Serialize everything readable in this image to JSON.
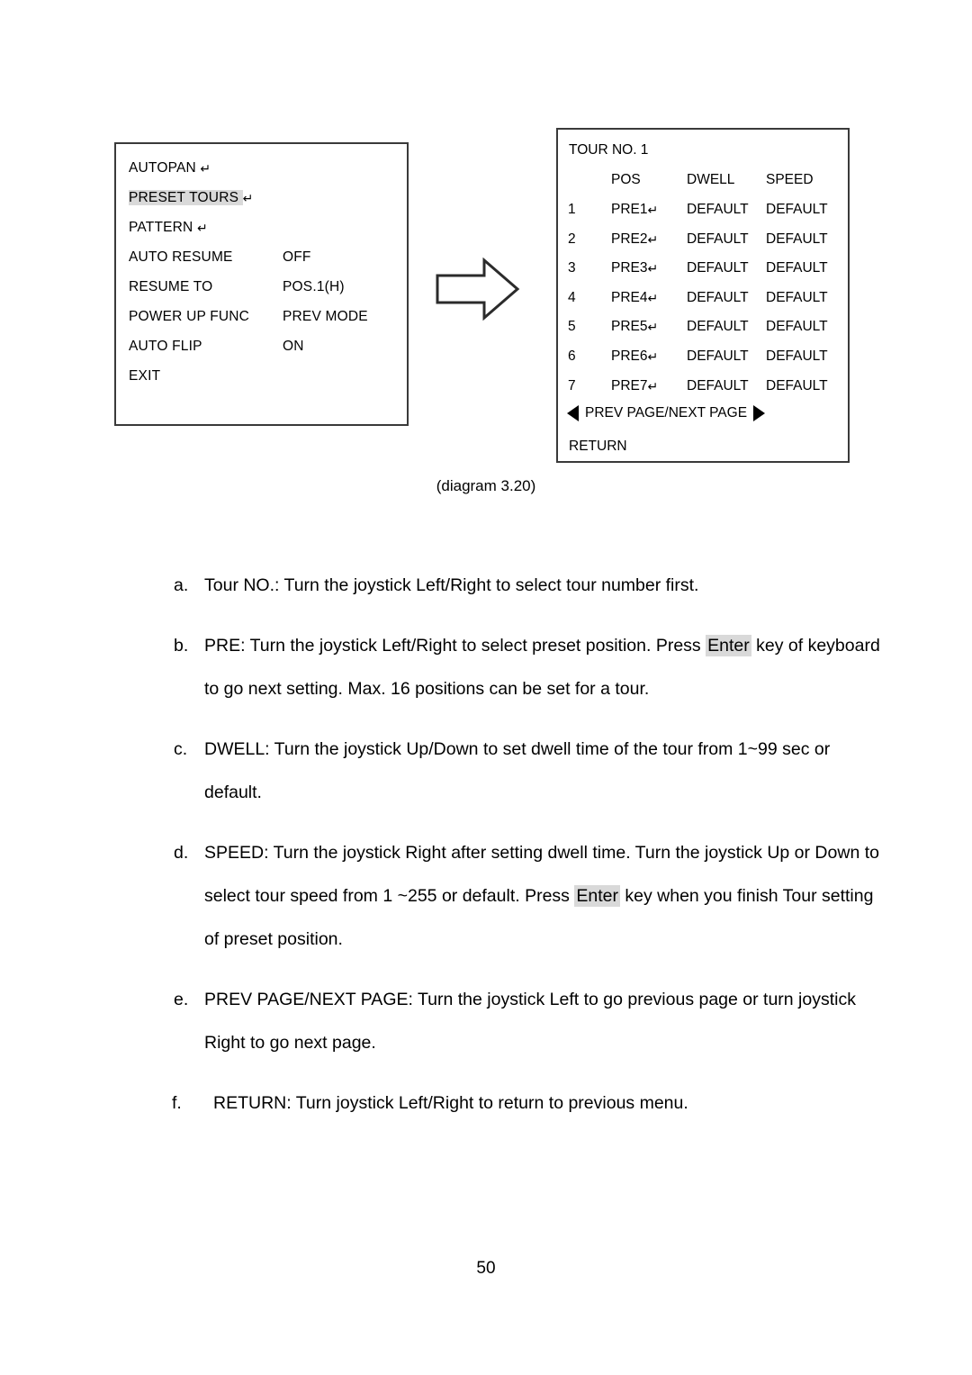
{
  "main_menu": {
    "rows": [
      {
        "label": "AUTOPAN",
        "enter_mark": "↵",
        "value": "",
        "highlight": false
      },
      {
        "label": "PRESET TOURS",
        "enter_mark": "↵",
        "value": "",
        "highlight": true
      },
      {
        "label": "PATTERN",
        "enter_mark": "↵",
        "value": "",
        "highlight": false
      },
      {
        "label": "AUTO RESUME",
        "enter_mark": "",
        "value": "OFF",
        "highlight": false
      },
      {
        "label": "RESUME TO",
        "enter_mark": "",
        "value": "POS.1(H)",
        "highlight": false
      },
      {
        "label": "POWER UP FUNC",
        "enter_mark": "",
        "value": "PREV MODE",
        "highlight": false
      },
      {
        "label": "AUTO FLIP",
        "enter_mark": "",
        "value": "ON",
        "highlight": false
      },
      {
        "label": "EXIT",
        "enter_mark": "",
        "value": "",
        "highlight": false
      }
    ]
  },
  "tour_menu": {
    "title": "TOUR NO.  1",
    "headers": {
      "index": "",
      "pos": "POS",
      "dwell": "DWELL",
      "speed": "SPEED"
    },
    "rows": [
      {
        "index": "1",
        "pos": "PRE1",
        "enter_mark": "↵",
        "dwell": "DEFAULT",
        "speed": "DEFAULT"
      },
      {
        "index": "2",
        "pos": "PRE2",
        "enter_mark": "↵",
        "dwell": "DEFAULT",
        "speed": "DEFAULT"
      },
      {
        "index": "3",
        "pos": "PRE3",
        "enter_mark": "↵",
        "dwell": "DEFAULT",
        "speed": "DEFAULT"
      },
      {
        "index": "4",
        "pos": "PRE4",
        "enter_mark": "↵",
        "dwell": "DEFAULT",
        "speed": "DEFAULT"
      },
      {
        "index": "5",
        "pos": "PRE5",
        "enter_mark": "↵",
        "dwell": "DEFAULT",
        "speed": "DEFAULT"
      },
      {
        "index": "6",
        "pos": "PRE6",
        "enter_mark": "↵",
        "dwell": "DEFAULT",
        "speed": "DEFAULT"
      },
      {
        "index": "7",
        "pos": "PRE7",
        "enter_mark": "↵",
        "dwell": "DEFAULT",
        "speed": "DEFAULT"
      }
    ],
    "pager_label": "PREV PAGE/NEXT PAGE",
    "return_label": "RETURN"
  },
  "caption": "(diagram 3.20)",
  "instructions": [
    {
      "marker": "a.",
      "wide": false,
      "parts": [
        {
          "text": "Tour NO.: Turn the joystick Left/Right to select tour number first.",
          "kbd": false
        }
      ]
    },
    {
      "marker": "b.",
      "wide": false,
      "parts": [
        {
          "text": "PRE: Turn the joystick Left/Right to select preset position. Press ",
          "kbd": false
        },
        {
          "text": "Enter",
          "kbd": true
        },
        {
          "text": " key of keyboard to go next setting. Max. 16 positions can be set for a tour.",
          "kbd": false
        }
      ]
    },
    {
      "marker": "c.",
      "wide": false,
      "parts": [
        {
          "text": "DWELL: Turn the joystick Up/Down to set dwell time of the tour from 1~99 sec or default.",
          "kbd": false
        }
      ]
    },
    {
      "marker": "d.",
      "wide": false,
      "parts": [
        {
          "text": "SPEED: Turn the joystick Right after setting dwell time. Turn the joystick Up or Down to select tour speed from 1 ~255 or default. Press ",
          "kbd": false
        },
        {
          "text": "Enter",
          "kbd": true
        },
        {
          "text": " key when you finish Tour setting of preset position.",
          "kbd": false
        }
      ]
    },
    {
      "marker": "e.",
      "wide": false,
      "parts": [
        {
          "text": "PREV PAGE/NEXT PAGE: Turn the joystick Left to go previous page or turn joystick Right to go next page.",
          "kbd": false
        }
      ]
    },
    {
      "marker": "f.",
      "wide": true,
      "parts": [
        {
          "text": "RETURN: Turn joystick Left/Right to return to previous menu.",
          "kbd": false
        }
      ]
    }
  ],
  "page_number": "50",
  "colors": {
    "highlight": "#d9d9d9",
    "border": "#3a3a3a",
    "text": "#000000"
  }
}
